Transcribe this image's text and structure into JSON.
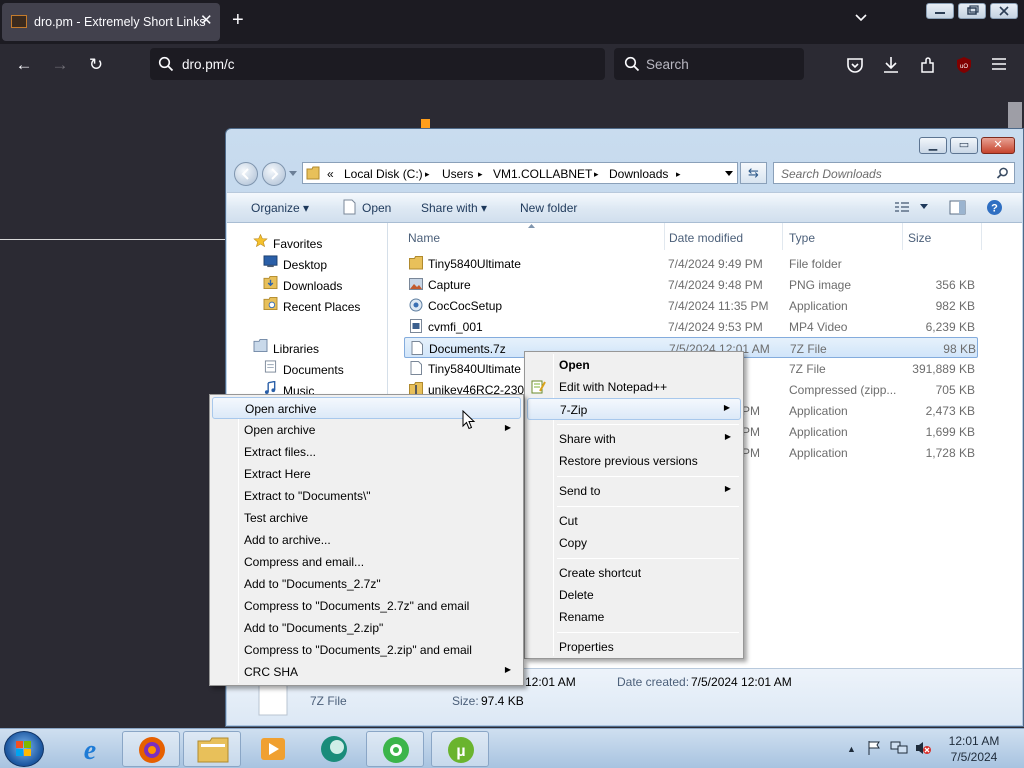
{
  "browser": {
    "tab_title": "dro.pm - Extremely Short Links",
    "tab_close": "✕",
    "new_tab": "+",
    "url": "dro.pm/c",
    "search_placeholder": "Search",
    "back": "←",
    "forward": "→",
    "reload": "↻"
  },
  "explorer": {
    "breadcrumb": {
      "prefix": "«",
      "parts": [
        "Local Disk (C:)",
        "Users",
        "VM1.COLLABNET",
        "Downloads"
      ],
      "sep": "▸"
    },
    "search_placeholder": "Search Downloads",
    "toolbar": {
      "organize": "Organize ▾",
      "open": "Open",
      "share_with": "Share with ▾",
      "new_folder": "New folder"
    },
    "nav": {
      "favorites": "Favorites",
      "desktop": "Desktop",
      "downloads": "Downloads",
      "recent": "Recent Places",
      "libraries": "Libraries",
      "documents": "Documents",
      "music": "Music"
    },
    "columns": {
      "name": "Name",
      "date": "Date modified",
      "type": "Type",
      "size": "Size"
    },
    "files": [
      {
        "name": "Tiny5840Ultimate",
        "date": "7/4/2024 9:49 PM",
        "type": "File folder",
        "size": "",
        "icon": "folder-icon"
      },
      {
        "name": "Capture",
        "date": "7/4/2024 9:48 PM",
        "type": "PNG image",
        "size": "356 KB",
        "icon": "image-icon"
      },
      {
        "name": "CocCocSetup",
        "date": "7/4/2024 11:35 PM",
        "type": "Application",
        "size": "982 KB",
        "icon": "app-icon"
      },
      {
        "name": "cvmfi_001",
        "date": "7/4/2024 9:53 PM",
        "type": "MP4 Video",
        "size": "6,239 KB",
        "icon": "video-icon"
      },
      {
        "name": "Documents.7z",
        "date": "7/5/2024 12:01 AM",
        "type": "7Z File",
        "size": "98 KB",
        "icon": "file-icon"
      },
      {
        "name": "Tiny5840Ultimate",
        "date": "",
        "type": "7Z File",
        "size": "391,889 KB",
        "icon": "file-icon"
      },
      {
        "name": "unikey46RC2-230",
        "date": "",
        "type": "Compressed (zipp...",
        "size": "705 KB",
        "icon": "zip-icon"
      },
      {
        "name": "",
        "date": "",
        "type": "Application",
        "size": "2,473 KB",
        "icon": ""
      },
      {
        "name": "",
        "date": "",
        "type": "Application",
        "size": "1,699 KB",
        "icon": ""
      },
      {
        "name": "",
        "date": "",
        "type": "Application",
        "size": "1,728 KB",
        "icon": ""
      }
    ],
    "date_tails": [
      "PM",
      "PM",
      "PM",
      "PM"
    ],
    "details": {
      "type": "7Z File",
      "modified": "12:01 AM",
      "size_label": "Size:",
      "size": "97.4 KB",
      "created_label": "Date created:",
      "created": "7/5/2024 12:01 AM"
    }
  },
  "context_menu": {
    "items": [
      "Open",
      "Edit with Notepad++",
      "7-Zip",
      "Share with",
      "Restore previous versions",
      "Send to",
      "Cut",
      "Copy",
      "Create shortcut",
      "Delete",
      "Rename",
      "Properties"
    ]
  },
  "zip_menu": {
    "items": [
      "Open archive",
      "Open archive",
      "Extract files...",
      "Extract Here",
      "Extract to \"Documents\\\"",
      "Test archive",
      "Add to archive...",
      "Compress and email...",
      "Add to \"Documents_2.7z\"",
      "Compress to \"Documents_2.7z\" and email",
      "Add to \"Documents_2.zip\"",
      "Compress to \"Documents_2.zip\" and email",
      "CRC SHA"
    ]
  },
  "taskbar": {
    "time": "12:01 AM",
    "date": "7/5/2024",
    "tray_up": "▲"
  },
  "colors": {
    "firefox_dark": "#1c1b22",
    "page_bg": "#2b2a33",
    "orange_accent": "#ff9e1b",
    "menu_highlight": "#dce9f8"
  }
}
